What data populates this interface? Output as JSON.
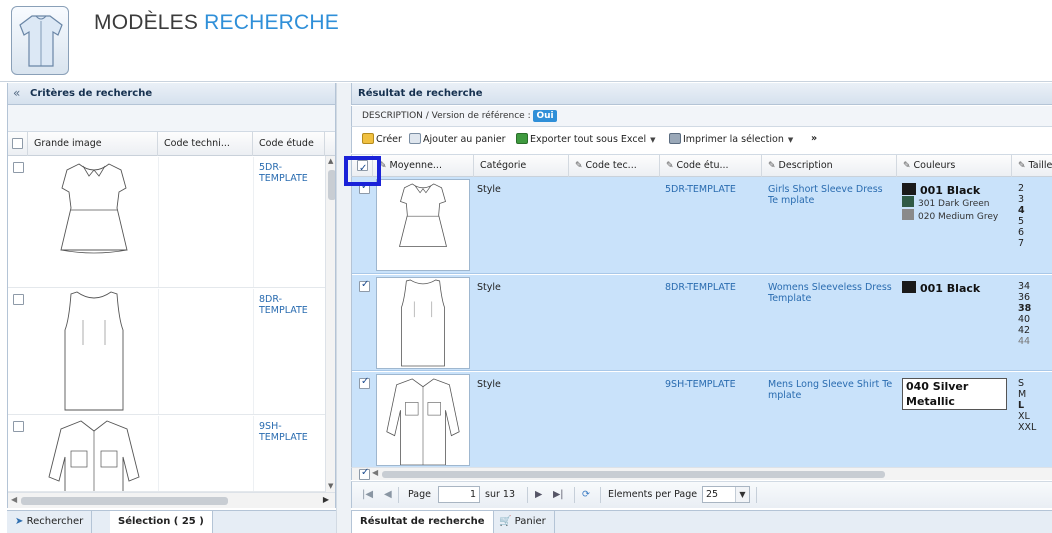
{
  "header": {
    "title_part1": "MODÈLES",
    "title_part2": "RECHERCHE",
    "accent_color": "#2f8fd8"
  },
  "left_panel": {
    "title": "Critères de recherche",
    "collapse_icon": "«",
    "columns": [
      "Grande image",
      "Code techni...",
      "Code étude"
    ],
    "rows": [
      {
        "code": "5DR-TEMPLATE"
      },
      {
        "code": "8DR-TEMPLATE"
      },
      {
        "code": "9SH-TEMPLATE"
      }
    ],
    "tabs": {
      "search": "Rechercher",
      "selection": "Sélection ( 25 )"
    }
  },
  "right_panel": {
    "title": "Résultat de recherche",
    "subheader_label": "DESCRIPTION / Version de référence :",
    "subheader_badge": "Oui",
    "toolbar": {
      "create": "Créer",
      "add_cart": "Ajouter au panier",
      "export": "Exporter tout sous Excel",
      "print": "Imprimer la sélection",
      "more": "»"
    },
    "columns": [
      "Moyenne...",
      "Catégorie",
      "Code tec...",
      "Code étu...",
      "Description",
      "Couleurs",
      "Taille"
    ],
    "rows": [
      {
        "category": "Style",
        "code": "5DR-TEMPLATE",
        "description": "Girls Short Sleeve Dress Te mplate",
        "colors": [
          {
            "label": "001 Black",
            "hex": "#1a1a1a"
          },
          {
            "label": "301 Dark Green",
            "hex": "#2f5a46"
          },
          {
            "label": "020 Medium Grey",
            "hex": "#8a8a8a"
          }
        ],
        "sizes": [
          "2",
          "3",
          "4",
          "5",
          "6",
          "7"
        ]
      },
      {
        "category": "Style",
        "code": "8DR-TEMPLATE",
        "description": "Womens Sleeveless Dress Template",
        "colors": [
          {
            "label": "001 Black",
            "hex": "#1a1a1a"
          }
        ],
        "sizes": [
          "34",
          "36",
          "38",
          "40",
          "42",
          "44"
        ]
      },
      {
        "category": "Style",
        "code": "9SH-TEMPLATE",
        "description": "Mens Long Sleeve Shirt Te mplate",
        "colors": [
          {
            "label": "040 Silver Metallic",
            "hex": "#ffffff"
          }
        ],
        "sizes": [
          "S",
          "M",
          "L",
          "XL",
          "XXL"
        ]
      }
    ],
    "pager": {
      "page_label": "Page",
      "page_value": "1",
      "of_label": "sur 13",
      "per_page_label": "Elements per Page",
      "per_page_value": "25"
    },
    "tabs": {
      "results": "Résultat de recherche",
      "cart": "Panier"
    }
  }
}
